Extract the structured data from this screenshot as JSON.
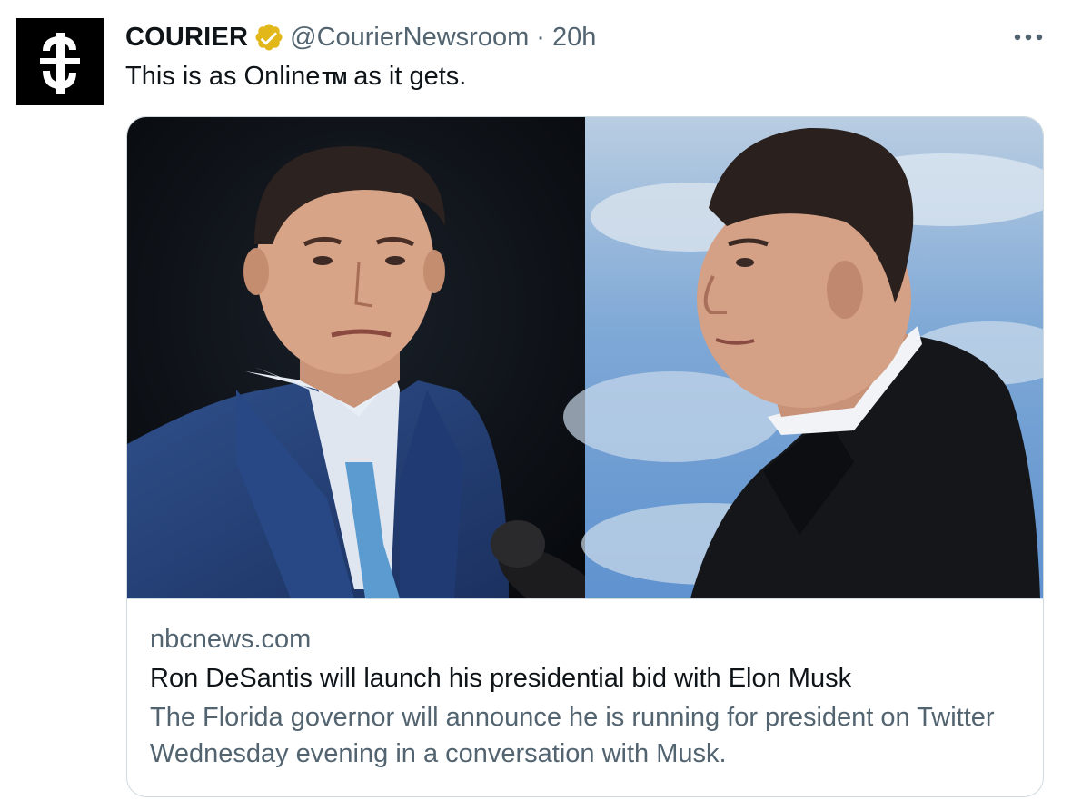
{
  "tweet": {
    "author": {
      "name": "COURIER",
      "handle": "@CourierNewsroom",
      "verified": true,
      "avatar_icon": "courier-logo-icon"
    },
    "separator": "·",
    "time": "20h",
    "more_icon": "more-horizontal-icon",
    "text_before": "This is as Online",
    "text_tm": "TM",
    "text_after": "as it gets."
  },
  "card": {
    "image_description": "Side-by-side photos: man in navy suit and light blue tie at a microphone (left), man in black jacket in profile against blue sky (right)",
    "domain": "nbcnews.com",
    "title": "Ron DeSantis will launch his presidential bid with Elon Musk",
    "description": "The Florida governor will announce he is running for president on Twitter Wednesday evening in a conversation with Musk."
  },
  "colors": {
    "text": "#0f1419",
    "secondary": "#536471",
    "border": "#cfd9de",
    "verified_gold": "#e2b719"
  }
}
